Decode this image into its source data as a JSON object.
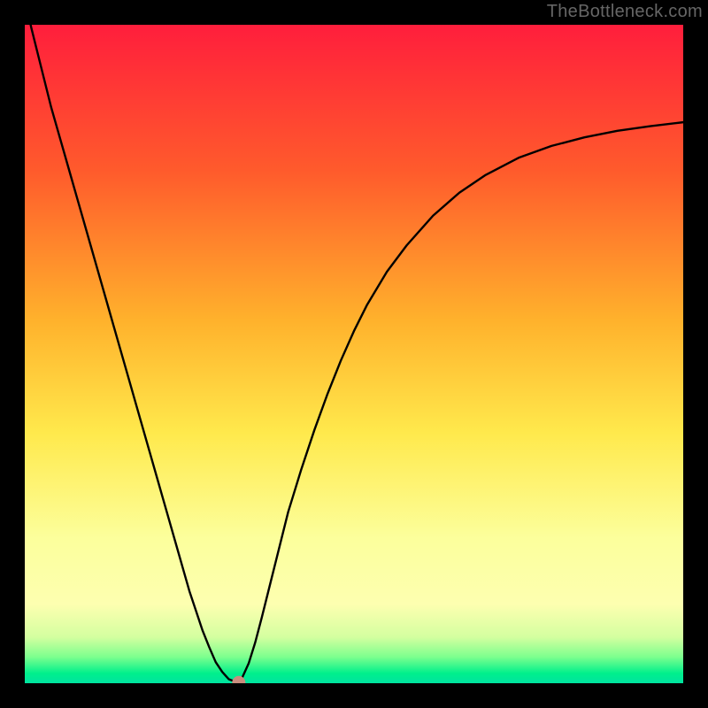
{
  "watermark": "TheBottleneck.com",
  "palette": {
    "frame": "#000000",
    "gradient": [
      "#ff1e3c",
      "#ff5a2c",
      "#ffb22c",
      "#ffe94c",
      "#fcff9c",
      "#9dff8a",
      "#00f58a",
      "#00e3a0"
    ],
    "curve": "#000000",
    "marker": "#c98d7e"
  },
  "chart_data": {
    "type": "line",
    "title": "",
    "xlabel": "",
    "ylabel": "",
    "xlim": [
      0,
      100
    ],
    "ylim": [
      0,
      100
    ],
    "x": [
      0,
      1,
      2,
      3,
      4,
      5,
      6,
      7,
      8,
      9,
      10,
      11,
      12,
      13,
      14,
      15,
      16,
      17,
      18,
      19,
      20,
      21,
      22,
      23,
      24,
      25,
      26,
      27,
      28,
      29,
      30,
      31,
      32,
      33,
      34,
      35,
      36,
      37,
      38,
      39,
      40,
      42,
      44,
      46,
      48,
      50,
      52,
      55,
      58,
      62,
      66,
      70,
      75,
      80,
      85,
      90,
      95,
      100
    ],
    "values": [
      104,
      99.5,
      95.5,
      91.5,
      87.5,
      84,
      80.5,
      77,
      73.5,
      70,
      66.5,
      63,
      59.5,
      56,
      52.5,
      49,
      45.5,
      42,
      38.5,
      35,
      31.5,
      28,
      24.5,
      21,
      17.5,
      14,
      11,
      8,
      5.5,
      3.2,
      1.7,
      0.6,
      0.2,
      0.8,
      3,
      6.2,
      10,
      14,
      18,
      22,
      26,
      32.5,
      38.5,
      44,
      49,
      53.5,
      57.5,
      62.5,
      66.5,
      71,
      74.5,
      77.2,
      79.8,
      81.6,
      82.9,
      83.9,
      84.6,
      85.2
    ],
    "marker": {
      "x": 32.5,
      "y": 0.1
    },
    "lower_band": {
      "from_y": 0,
      "to_y": 6
    }
  }
}
